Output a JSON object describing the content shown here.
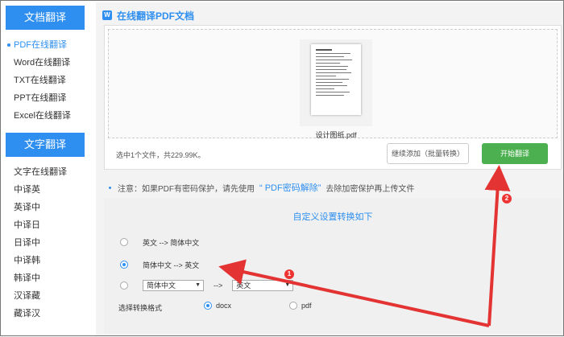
{
  "sidebar": {
    "section1_title": "文档翻译",
    "section1_items": [
      {
        "label": "PDF在线翻译",
        "active": true
      },
      {
        "label": "Word在线翻译"
      },
      {
        "label": "TXT在线翻译"
      },
      {
        "label": "PPT在线翻译"
      },
      {
        "label": "Excel在线翻译"
      }
    ],
    "section2_title": "文字翻译",
    "section2_items": [
      {
        "label": "文字在线翻译"
      },
      {
        "label": "中译英"
      },
      {
        "label": "英译中"
      },
      {
        "label": "中译日"
      },
      {
        "label": "日译中"
      },
      {
        "label": "中译韩"
      },
      {
        "label": "韩译中"
      },
      {
        "label": "汉译藏"
      },
      {
        "label": "藏译汉"
      }
    ]
  },
  "main": {
    "title": "在线翻译PDF文档",
    "title_icon_letter": "W",
    "file_name": "设计图纸.pdf",
    "upload_info": "选中1个文件，共229.99K。",
    "continue_button": "继续添加（批量转换）",
    "start_button": "开始翻译",
    "notice_prefix": "注意：如果PDF有密码保护，请先使用",
    "notice_link": "“ PDF密码解除”",
    "notice_suffix": "去除加密保护再上传文件",
    "settings_title": "自定义设置转换如下",
    "option1": "英文 --> 简体中文",
    "option2": "简体中文 --> 英文",
    "option3_from": "简体中文",
    "option3_sep": "-->",
    "option3_to": "英文",
    "format_label": "选择转换格式",
    "format_docx": "docx",
    "format_pdf": "pdf"
  },
  "annotations": {
    "badge1": "1",
    "badge2": "2",
    "arrow_color": "#e33333"
  },
  "colors": {
    "accent": "#2f8ff0",
    "start_button": "#4cb050"
  }
}
